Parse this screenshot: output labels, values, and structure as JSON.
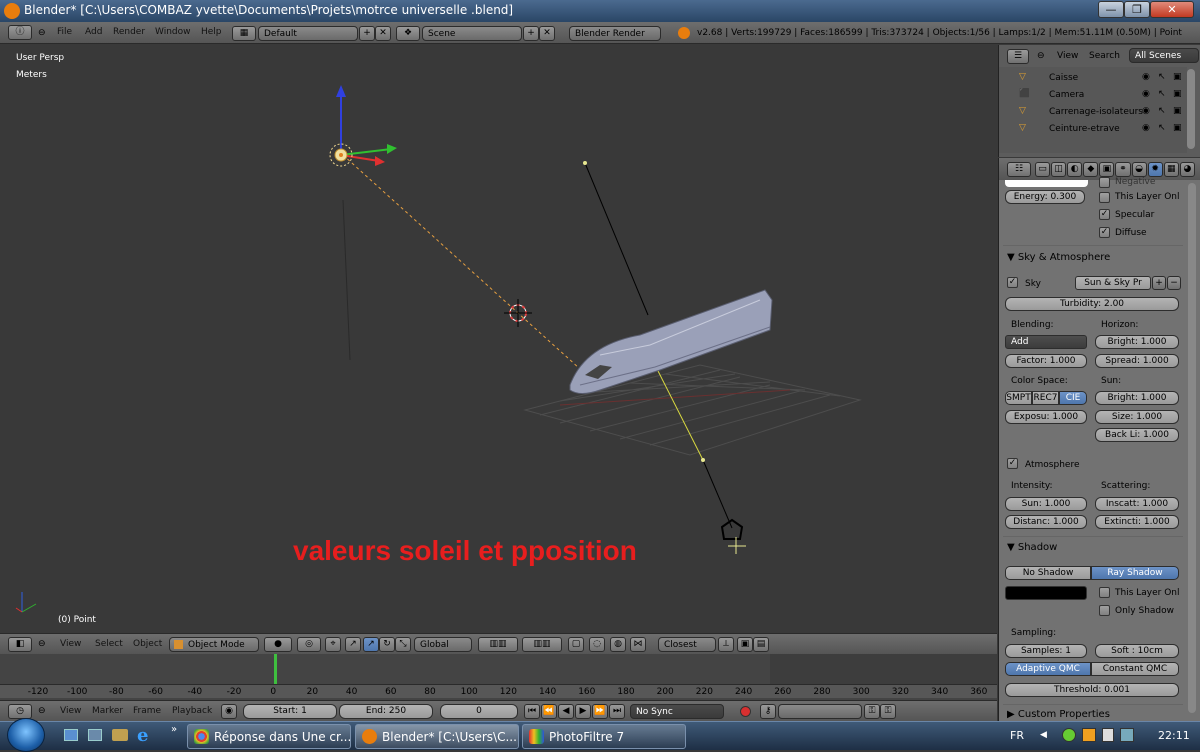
{
  "window": {
    "title": "Blender* [C:\\Users\\COMBAZ yvette\\Documents\\Projets\\motrce universelle .blend]",
    "minimize": "—",
    "maximize": "❐",
    "close": "✕"
  },
  "header": {
    "menus": [
      "File",
      "Add",
      "Render",
      "Window",
      "Help"
    ],
    "layout": "Default",
    "scene": "Scene",
    "engine": "Blender Render",
    "stats": "v2.68 | Verts:199729 | Faces:186599 | Tris:373724 | Objects:1/56 | Lamps:1/2 | Mem:51.11M (0.50M) | Point"
  },
  "viewport": {
    "view_name": "User Persp",
    "units": "Meters",
    "object_label": "(0) Point",
    "overlay_text": "valeurs soleil et pposition"
  },
  "view3d_header": {
    "menus": [
      "View",
      "Select",
      "Object"
    ],
    "mode": "Object Mode",
    "orientation": "Global",
    "snap": "Closest"
  },
  "timeline": {
    "ticks": [
      "-120",
      "-100",
      "-80",
      "-60",
      "-40",
      "-20",
      "0",
      "20",
      "40",
      "60",
      "80",
      "100",
      "120",
      "140",
      "160",
      "180",
      "200",
      "220",
      "240",
      "260",
      "280",
      "300",
      "320",
      "340",
      "360"
    ],
    "menus": [
      "View",
      "Marker",
      "Frame",
      "Playback"
    ],
    "start": "Start: 1",
    "end": "End: 250",
    "current": "0",
    "sync": "No Sync"
  },
  "outliner": {
    "menus": [
      "View",
      "Search"
    ],
    "scope": "All Scenes",
    "items": [
      "Caisse",
      "Camera",
      "Carrenage-isolateurs",
      "Ceinture-etrave"
    ]
  },
  "properties": {
    "energy": "Energy: 0.300",
    "negative": "Negative",
    "this_layer": "This Layer Onl",
    "specular": "Specular",
    "diffuse": "Diffuse",
    "sky_panel": "Sky & Atmosphere",
    "sky": "Sky",
    "sky_preset": "Sun & Sky Pr",
    "turbidity": "Turbidity: 2.00",
    "blending": "Blending:",
    "horizon": "Horizon:",
    "blend_mode": "Add",
    "h_bright": "Bright: 1.000",
    "factor": "Factor: 1.000",
    "spread": "Spread: 1.000",
    "color_space": "Color Space:",
    "sun": "Sun:",
    "cs_options": [
      "SMPT",
      "REC7",
      "CIE"
    ],
    "s_bright": "Bright: 1.000",
    "exposure": "Exposu: 1.000",
    "size": "Size: 1.000",
    "back_light": "Back Li: 1.000",
    "atmosphere": "Atmosphere",
    "intensity": "Intensity:",
    "scattering": "Scattering:",
    "i_sun": "Sun: 1.000",
    "inscatt": "Inscatt: 1.000",
    "distance": "Distanc: 1.000",
    "extinction": "Extincti: 1.000",
    "shadow_panel": "Shadow",
    "no_shadow": "No Shadow",
    "ray_shadow": "Ray Shadow",
    "shadow_layer": "This Layer Onl",
    "only_shadow": "Only Shadow",
    "sampling": "Sampling:",
    "samples": "Samples: 1",
    "soft": "Soft : 10cm",
    "adaptive": "Adaptive QMC",
    "constant": "Constant QMC",
    "threshold": "Threshold: 0.001",
    "custom_panel": "Custom Properties"
  },
  "taskbar": {
    "tasks": [
      "Réponse dans Une cr...",
      "Blender* [C:\\Users\\C...",
      "PhotoFiltre 7"
    ],
    "lang": "FR",
    "clock": "22:11",
    "more": "»"
  },
  "colors": {
    "overlay_text": "#e81e1e",
    "selected_button": "#5680b8",
    "viewport_bg": "#393939"
  }
}
